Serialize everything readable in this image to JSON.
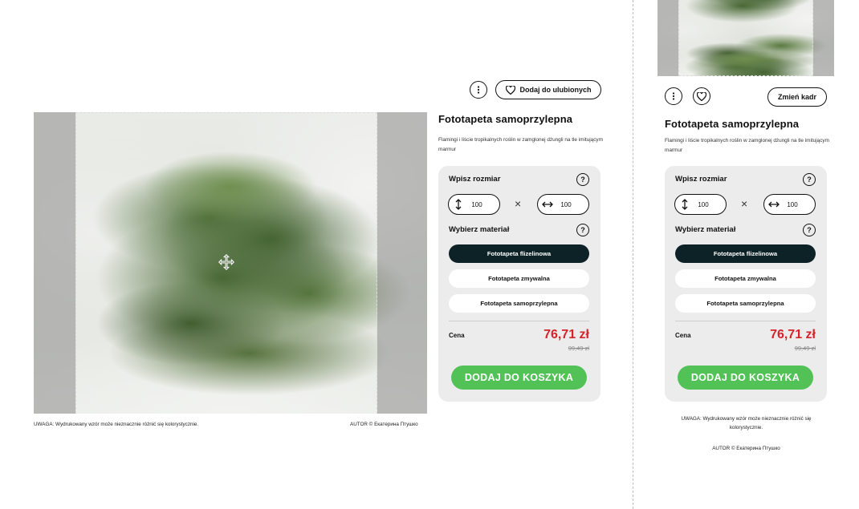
{
  "desktop": {
    "favorite_label": "Dodaj do ulubionych",
    "product_title": "Fototapeta samoprzylepna",
    "description": "Flamingi i liście tropikalnych roślin w zamglonej dżungli na tle imitującym marmur",
    "size_label": "Wpisz rozmiar",
    "help_label": "?",
    "height_value": "100",
    "width_value": "100",
    "times_sign": "×",
    "material_label": "Wybierz materiał",
    "materials": [
      "Fototapeta flizelinowa",
      "Fototapeta zmywalna",
      "Fototapeta samoprzylepna"
    ],
    "selected_material": "Fototapeta flizelinowa",
    "price_label": "Cena",
    "price": "76,71 zł",
    "old_price": "99,49 zł",
    "cart_label": "DODAJ DO KOSZYKA",
    "warning": "UWAGA: Wydrukowany wzór może nieznacznie różnić się kolorystycznie.",
    "author": "AUTOR © Екатерина Птушко"
  },
  "mobile": {
    "crop_label": "Zmień kadr",
    "product_title": "Fototapeta samoprzylepna",
    "description": "Flamingi i liście tropikalnych roślin w zamglonej dżungli na tle imitującym marmur",
    "size_label": "Wpisz rozmiar",
    "help_label": "?",
    "height_value": "100",
    "width_value": "100",
    "times_sign": "×",
    "material_label": "Wybierz materiał",
    "materials": [
      "Fototapeta flizelinowa",
      "Fototapeta zmywalna",
      "Fototapeta samoprzylepna"
    ],
    "price_label": "Cena",
    "price": "76,71 zł",
    "old_price": "99,49 zł",
    "cart_label": "DODAJ DO KOSZYKA",
    "warning": "UWAGA: Wydrukowany wzór może nieznacznie różnić się kolorystycznie.",
    "author": "AUTOR © Екатерина Птушко"
  },
  "colors": {
    "accent_green": "#52c257",
    "price_red": "#d6232a",
    "selected_dark": "#0d2226",
    "panel_gray": "#ececec"
  }
}
